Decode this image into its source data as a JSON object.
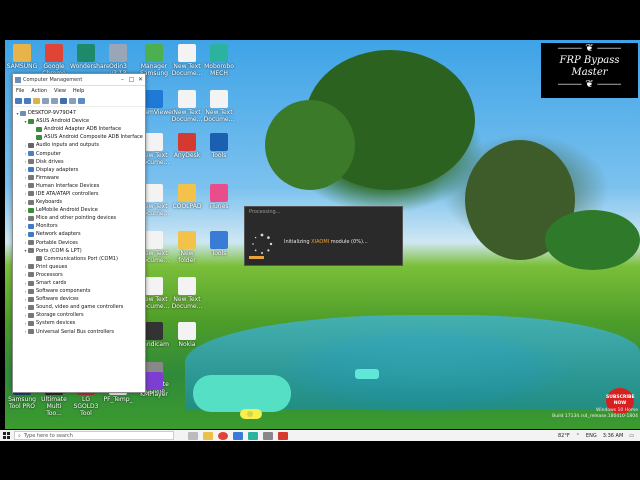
{
  "watermark": {
    "ornament_top": "⸻ ❦ ⸻",
    "title": "FRP Bypass Master",
    "ornament_bottom": "⸻ ❦ ⸻"
  },
  "desktop_icons": [
    {
      "id": "ic1",
      "label": "SAMSUNG",
      "color": "#e8b44a"
    },
    {
      "id": "ic2",
      "label": "Google Chrome",
      "color": "#e04436"
    },
    {
      "id": "ic3",
      "label": "Wondershare",
      "color": "#1e8a6a"
    },
    {
      "id": "ic4",
      "label": "Odin3 v3.13",
      "color": "#9aa6b8"
    },
    {
      "id": "ic5",
      "label": "Manager Samsung",
      "color": "#4caf50"
    },
    {
      "id": "ic6",
      "label": "New Text Docume...",
      "color": "#f3f3f3"
    },
    {
      "id": "ic7",
      "label": "Moborobo MECH",
      "color": "#2bb3a0"
    },
    {
      "id": "ic8",
      "label": "TeamViewer",
      "color": "#1f7ad6"
    },
    {
      "id": "ic9",
      "label": "New Text Docume...",
      "color": "#f3f3f3"
    },
    {
      "id": "ic10",
      "label": "New Text Docume...",
      "color": "#f3f3f3"
    },
    {
      "id": "ic11",
      "label": "New Text Docume...",
      "color": "#f3f3f3"
    },
    {
      "id": "ic12",
      "label": "AnyDesk",
      "color": "#d43a2f"
    },
    {
      "id": "ic13",
      "label": "Tools",
      "color": "#1b5fb0"
    },
    {
      "id": "ic14",
      "label": "New Text Docume...",
      "color": "#f3f3f3"
    },
    {
      "id": "ic15",
      "label": "COOLPAD",
      "color": "#f2c24a"
    },
    {
      "id": "ic16",
      "label": "iTunes",
      "color": "#e84f8a"
    },
    {
      "id": "ic17",
      "label": "New Text Docume...",
      "color": "#f3f3f3"
    },
    {
      "id": "ic18",
      "label": "New folder",
      "color": "#f2c24a"
    },
    {
      "id": "ic19",
      "label": "Tools",
      "color": "#3a7bd5"
    },
    {
      "id": "ic20",
      "label": "New Text Docume...",
      "color": "#f3f3f3"
    },
    {
      "id": "ic21",
      "label": "New Text Docume...",
      "color": "#f3f3f3"
    },
    {
      "id": "ic22",
      "label": "Nokia",
      "color": "#f3f3f3"
    },
    {
      "id": "ic23",
      "label": "Bandicam",
      "color": "#333333"
    },
    {
      "id": "ic24",
      "label": "Root Note Gazelle",
      "color": "#888888"
    },
    {
      "id": "ic25",
      "label": "Samsung Tool PRO",
      "color": "#1a3c7a"
    },
    {
      "id": "ic26",
      "label": "Ultimate Multi Too...",
      "color": "#2b2b2b"
    },
    {
      "id": "ic27",
      "label": "LG SGOLD3 Tool",
      "color": "#b03030"
    },
    {
      "id": "ic28",
      "label": "PF_Temp_",
      "color": "#eeeeee"
    },
    {
      "id": "ic29",
      "label": "KMPlayer",
      "color": "#7d3fd1"
    }
  ],
  "computer_management": {
    "title": "Computer Management",
    "menu": [
      "File",
      "Action",
      "View",
      "Help"
    ],
    "tree": [
      {
        "label": "DESKTOP-9V79D47",
        "level": 0,
        "arrow": "▾",
        "color": "#6b8fb5"
      },
      {
        "label": "ASUS Android Device",
        "level": 1,
        "arrow": "▾",
        "color": "#3a8c3a"
      },
      {
        "label": "Android Adapter ADB Interface",
        "level": 2,
        "arrow": "",
        "color": "#3a8c3a"
      },
      {
        "label": "ASUS Android Composite ADB Interface",
        "level": 2,
        "arrow": "",
        "color": "#3a8c3a"
      },
      {
        "label": "Audio inputs and outputs",
        "level": 1,
        "arrow": "›",
        "color": "#666"
      },
      {
        "label": "Computer",
        "level": 1,
        "arrow": "›",
        "color": "#4a80c0"
      },
      {
        "label": "Disk drives",
        "level": 1,
        "arrow": "›",
        "color": "#777"
      },
      {
        "label": "Display adapters",
        "level": 1,
        "arrow": "›",
        "color": "#3d7ac8"
      },
      {
        "label": "Firmware",
        "level": 1,
        "arrow": "›",
        "color": "#777"
      },
      {
        "label": "Human Interface Devices",
        "level": 1,
        "arrow": "›",
        "color": "#777"
      },
      {
        "label": "IDE ATA/ATAPI controllers",
        "level": 1,
        "arrow": "›",
        "color": "#777"
      },
      {
        "label": "Keyboards",
        "level": 1,
        "arrow": "›",
        "color": "#777"
      },
      {
        "label": "LeMobile Android Device",
        "level": 1,
        "arrow": "›",
        "color": "#3a8c3a"
      },
      {
        "label": "Mice and other pointing devices",
        "level": 1,
        "arrow": "›",
        "color": "#777"
      },
      {
        "label": "Monitors",
        "level": 1,
        "arrow": "›",
        "color": "#3d7ac8"
      },
      {
        "label": "Network adapters",
        "level": 1,
        "arrow": "›",
        "color": "#3d7ac8"
      },
      {
        "label": "Portable Devices",
        "level": 1,
        "arrow": "›",
        "color": "#777"
      },
      {
        "label": "Ports (COM & LPT)",
        "level": 1,
        "arrow": "▾",
        "color": "#777"
      },
      {
        "label": "Communications Port (COM1)",
        "level": 2,
        "arrow": "",
        "color": "#777"
      },
      {
        "label": "Print queues",
        "level": 1,
        "arrow": "›",
        "color": "#777"
      },
      {
        "label": "Processors",
        "level": 1,
        "arrow": "›",
        "color": "#777"
      },
      {
        "label": "Smart cards",
        "level": 1,
        "arrow": "›",
        "color": "#777"
      },
      {
        "label": "Software components",
        "level": 1,
        "arrow": "›",
        "color": "#777"
      },
      {
        "label": "Software devices",
        "level": 1,
        "arrow": "›",
        "color": "#777"
      },
      {
        "label": "Sound, video and game controllers",
        "level": 1,
        "arrow": "›",
        "color": "#777"
      },
      {
        "label": "Storage controllers",
        "level": 1,
        "arrow": "›",
        "color": "#777"
      },
      {
        "label": "System devices",
        "level": 1,
        "arrow": "›",
        "color": "#777"
      },
      {
        "label": "Universal Serial Bus controllers",
        "level": 1,
        "arrow": "›",
        "color": "#777"
      }
    ]
  },
  "dialog": {
    "title": "Processing...",
    "message_prefix": "Initializing ",
    "message_highlight": "XIAOMI",
    "message_suffix": " module (0%)...",
    "progress": 0
  },
  "subscribe": {
    "line1": "SUBSCRIBE",
    "line2": "NOW"
  },
  "windows_mark": [
    "Windows 10 Home",
    "Build 17134.rs4_release.180410-1804"
  ],
  "taskbar": {
    "search_placeholder": "Type here to search",
    "tray_temp": "82°F",
    "tray_lang": "ENG",
    "time": "3:36 AM"
  }
}
